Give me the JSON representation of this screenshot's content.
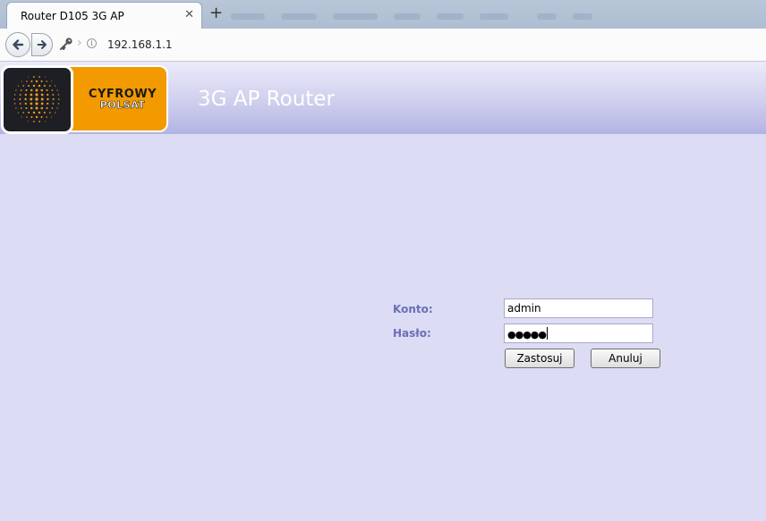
{
  "browser": {
    "tab_title": "Router D105 3G AP",
    "close_glyph": "✕",
    "new_tab_glyph": "+",
    "url": "192.168.1.1",
    "info_glyph": "i"
  },
  "header": {
    "logo_line1": "CYFROWY",
    "logo_line2": "POLSAT",
    "title": "3G AP Router"
  },
  "login": {
    "account_label": "Konto:",
    "account_value": "admin",
    "password_label": "Hasło:",
    "password_value": "●●●●●",
    "apply_label": "Zastosuj",
    "cancel_label": "Anuluj"
  },
  "colors": {
    "page_bg": "#dcdcf4",
    "label_color": "#6b6fb5",
    "logo_orange": "#f39a00"
  }
}
